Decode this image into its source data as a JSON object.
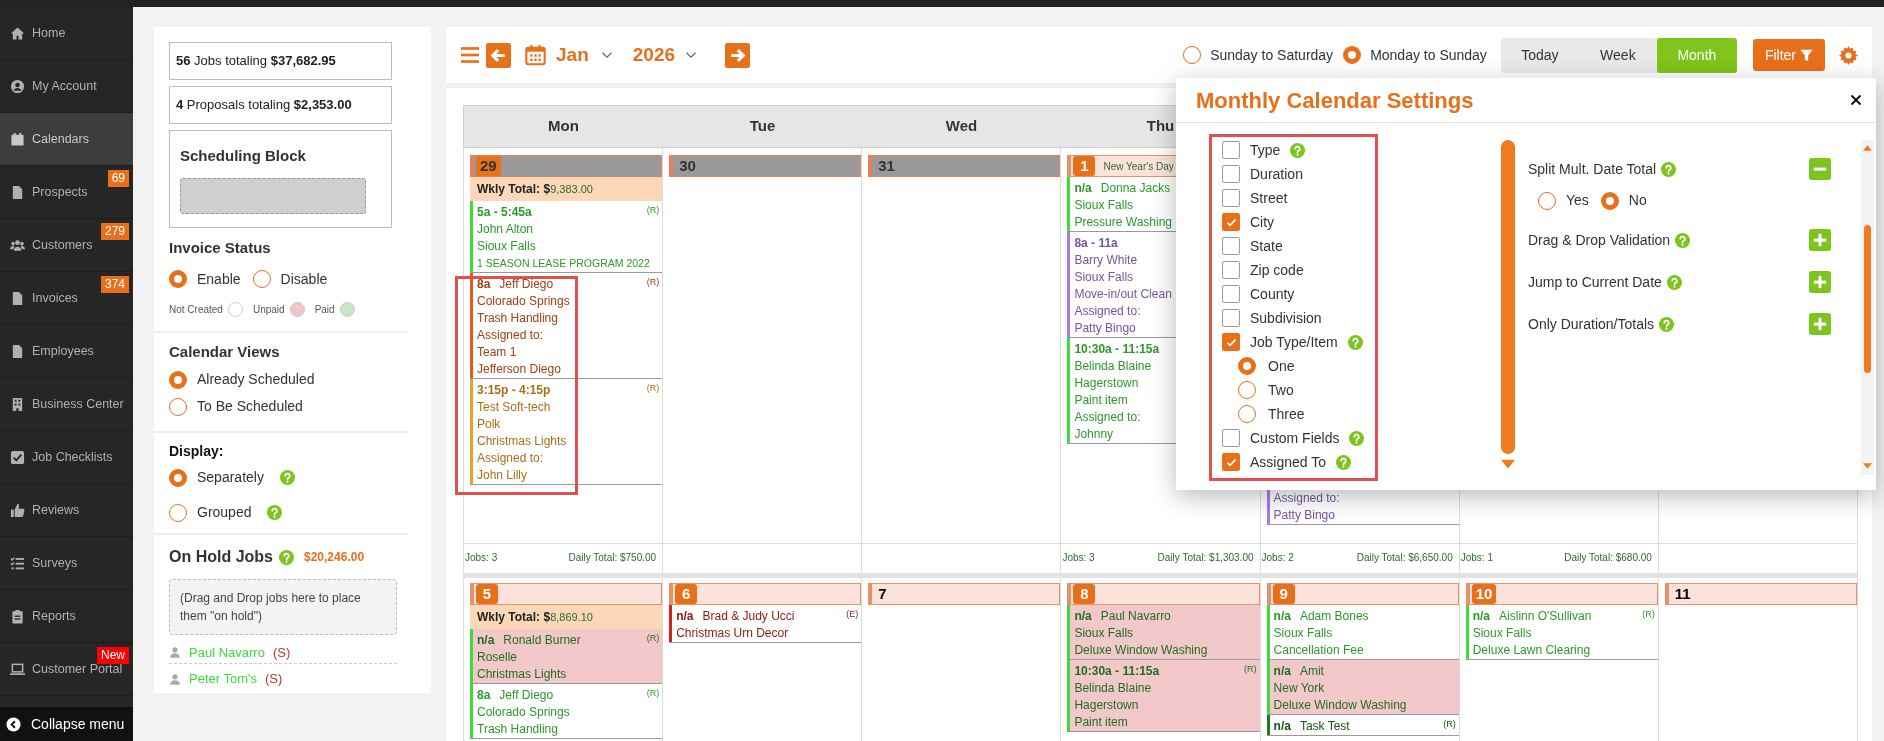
{
  "sidebar": {
    "items": [
      {
        "label": "Home",
        "selected": false
      },
      {
        "label": "My Account",
        "selected": false
      },
      {
        "label": "Calendars",
        "selected": true
      },
      {
        "label": "Prospects",
        "selected": false,
        "badge": {
          "text": "69",
          "color": "#e8701a"
        }
      },
      {
        "label": "Customers",
        "selected": false,
        "badge": {
          "text": "279",
          "color": "#e8701a"
        }
      },
      {
        "label": "Invoices",
        "selected": false,
        "badge": {
          "text": "374",
          "color": "#e8701a"
        }
      },
      {
        "label": "Employees",
        "selected": false
      },
      {
        "label": "Business Center",
        "selected": false
      },
      {
        "label": "Job Checklists",
        "selected": false
      },
      {
        "label": "Reviews",
        "selected": false
      },
      {
        "label": "Surveys",
        "selected": false
      },
      {
        "label": "Reports",
        "selected": false
      },
      {
        "label": "Customer Portal",
        "selected": false,
        "badge": {
          "text": "New",
          "color": "#ff0000"
        }
      }
    ],
    "collapse": "Collapse menu"
  },
  "summary": [
    "**56** Jobs totaling **$37,682.95**",
    "**4** Proposals totaling **$2,353.00**"
  ],
  "scheduling_block": {
    "title": "Scheduling Block"
  },
  "invoice_status": {
    "title": "Invoice Status",
    "options": [
      {
        "label": "Enable",
        "selected": true
      },
      {
        "label": "Disable",
        "selected": false
      }
    ],
    "legend": [
      {
        "label": "Not Created",
        "color": "#ffffff"
      },
      {
        "label": "Unpaid",
        "color": "#f2c6c9"
      },
      {
        "label": "Paid",
        "color": "#c6e8c6"
      }
    ]
  },
  "calendar_views": {
    "title": "Calendar Views",
    "options": [
      {
        "label": "Already Scheduled",
        "selected": true
      },
      {
        "label": "To Be Scheduled",
        "selected": false
      }
    ]
  },
  "display": {
    "title": "Display:",
    "options": [
      {
        "label": "Separately",
        "selected": true
      },
      {
        "label": "Grouped",
        "selected": false
      }
    ]
  },
  "on_hold": {
    "title": "On Hold Jobs",
    "total": "$20,246.00",
    "hint": "(Drag and Drop jobs here to place them \"on hold\")",
    "jobs": [
      {
        "name": "Paul Navarro",
        "tag": "(S)"
      },
      {
        "name": "Peter Tom's",
        "tag": "(S)"
      }
    ]
  },
  "toolbar": {
    "month": "Jan",
    "year": "2026",
    "week_start": [
      {
        "label": "Sunday to Saturday",
        "selected": false
      },
      {
        "label": "Monday to Sunday",
        "selected": true
      }
    ],
    "views": [
      {
        "label": "Today",
        "selected": false
      },
      {
        "label": "Week",
        "selected": false
      },
      {
        "label": "Month",
        "selected": true
      }
    ],
    "filter": "Filter"
  },
  "calendar": {
    "weekdays": [
      "Mon",
      "Tue",
      "Wed",
      "Thu"
    ],
    "weeks": [
      {
        "days": [
          {
            "date": "29",
            "other_month": true,
            "has_jobs": true,
            "weekly_total": {
              "label": "Wkly Total: $",
              "amount": "9,383.00"
            },
            "events": [
              {
                "time": "5a - 5:45a",
                "lines": [
                  "John Alton",
                  "Sioux Falls",
                  "1 SEASON LEASE PROGRAM 2022"
                ],
                "tag": "(R)",
                "color": "#3ddc3d",
                "unpaid": false
              },
              {
                "time": "8a",
                "name": "Jeff Diego",
                "lines": [
                  "Colorado Springs",
                  "Trash Handling",
                  "Assigned to:",
                  "Team 1",
                  "Jefferson Diego"
                ],
                "tag": "(R)",
                "color": "#e8581a",
                "unpaid": false
              },
              {
                "time": "3:15p - 4:15p",
                "lines": [
                  "Test Soft-tech",
                  "Polk",
                  "Christmas Lights",
                  "Assigned to:",
                  "John Lilly"
                ],
                "tag": "(R)",
                "color": "#f0a020",
                "unpaid": false
              }
            ],
            "jobs": "Jobs: 3",
            "daily_total": "Daily Total: $750.00"
          },
          {
            "date": "30",
            "other_month": true,
            "has_jobs": false
          },
          {
            "date": "31",
            "other_month": true,
            "has_jobs": false
          },
          {
            "date": "1",
            "other_month": false,
            "has_jobs": true,
            "holiday": "New Year's Day",
            "events": [
              {
                "time": "n/a",
                "name": "Donna Jacks",
                "lines": [
                  "Sioux Falls",
                  "Pressure Washing"
                ],
                "color": "#3ddc3d",
                "unpaid": false
              },
              {
                "time": "8a - 11a",
                "lines": [
                  "Barry White",
                  "Sioux Falls",
                  "Move-in/out Clean",
                  "Assigned to:",
                  "Patty Bingo"
                ],
                "color": "#a77ae8",
                "unpaid": false
              },
              {
                "time": "10:30a - 11:15a",
                "lines": [
                  "Belinda Blaine",
                  "Hagerstown",
                  "Paint item",
                  "Assigned to:",
                  "Johnny"
                ],
                "color": "#3ddc3d",
                "unpaid": false
              }
            ],
            "jobs": "Jobs: 3",
            "daily_total": "Daily Total: $1,303.00"
          },
          {
            "events": [
              {
                "lines": [
                  "Assigned to:",
                  "Patty Bingo"
                ],
                "color": "#a77ae8",
                "unpaid": false
              }
            ],
            "jobs": "Jobs: 2",
            "daily_total": "Daily Total: $6,650.00"
          },
          {
            "jobs": "Jobs: 1",
            "daily_total": "Daily Total: $680.00"
          }
        ]
      },
      {
        "days": [
          {
            "date": "5",
            "other_month": false,
            "has_jobs": true,
            "weekly_total": {
              "label": "Wkly Total: $",
              "amount": "8,869.10"
            },
            "events": [
              {
                "time": "n/a",
                "name": "Ronald Burner",
                "lines": [
                  "Roselle",
                  "Christmas Lights"
                ],
                "tag": "(R)",
                "color": "#3ddc3d",
                "unpaid": true
              },
              {
                "time": "8a",
                "name": "Jeff Diego",
                "lines": [
                  "Colorado Springs",
                  "Trash Handling"
                ],
                "tag": "(R)",
                "color": "#3ddc3d",
                "unpaid": false
              }
            ]
          },
          {
            "date": "6",
            "other_month": false,
            "has_jobs": true,
            "events": [
              {
                "time": "n/a",
                "name": "Brad & Judy Ucci",
                "lines": [
                  "Christmas Urn Decor"
                ],
                "tag": "(E)",
                "color": "#d42020",
                "unpaid": false
              }
            ]
          },
          {
            "date": "7",
            "other_month": false,
            "has_jobs": false
          },
          {
            "date": "8",
            "other_month": false,
            "has_jobs": true,
            "events": [
              {
                "time": "n/a",
                "name": "Paul Navarro",
                "lines": [
                  "Sioux Falls",
                  "Deluxe Window Washing"
                ],
                "color": "#3ddc3d",
                "unpaid": true
              },
              {
                "time": "10:30a - 11:15a",
                "lines": [
                  "Belinda Blaine",
                  "Hagerstown",
                  "Paint item"
                ],
                "tag": "(R)",
                "color": "#3ddc3d",
                "unpaid": true
              }
            ]
          },
          {
            "date": "9",
            "other_month": false,
            "has_jobs": true,
            "events": [
              {
                "time": "n/a",
                "name": "Adam Bones",
                "lines": [
                  "Sioux Falls",
                  "Cancellation Fee"
                ],
                "color": "#3ddc3d",
                "unpaid": false
              },
              {
                "time": "n/a",
                "name": "Amit",
                "lines": [
                  "New York",
                  "Deluxe Window Washing"
                ],
                "color": "#3ddc3d",
                "unpaid": true
              },
              {
                "time": "n/a",
                "name": "Task Test",
                "tag": "(R)",
                "color": "#1e7a1e",
                "unpaid": false
              }
            ]
          },
          {
            "date": "10",
            "other_month": false,
            "has_jobs": true,
            "events": [
              {
                "time": "n/a",
                "name": "Aislinn O'Sullivan",
                "lines": [
                  "Sioux Falls",
                  "Deluxe Lawn Clearing"
                ],
                "tag": "(R)",
                "color": "#3ddc3d",
                "unpaid": false
              }
            ]
          },
          {
            "date": "11",
            "other_month": false,
            "has_jobs": false
          }
        ]
      }
    ]
  },
  "settings": {
    "title": "Monthly Calendar Settings",
    "fields": [
      {
        "label": "Type",
        "checked": false,
        "help": true
      },
      {
        "label": "Duration",
        "checked": false,
        "help": false
      },
      {
        "label": "Street",
        "checked": false,
        "help": false
      },
      {
        "label": "City",
        "checked": true,
        "help": false
      },
      {
        "label": "State",
        "checked": false,
        "help": false
      },
      {
        "label": "Zip code",
        "checked": false,
        "help": false
      },
      {
        "label": "County",
        "checked": false,
        "help": false
      },
      {
        "label": "Subdivision",
        "checked": false,
        "help": false
      },
      {
        "label": "Job Type/Item",
        "checked": true,
        "help": true,
        "children": [
          {
            "label": "One",
            "selected": true
          },
          {
            "label": "Two",
            "selected": false
          },
          {
            "label": "Three",
            "selected": false
          }
        ]
      },
      {
        "label": "Custom Fields",
        "checked": false,
        "help": true
      },
      {
        "label": "Assigned To",
        "checked": true,
        "help": true
      }
    ],
    "options": [
      {
        "label": "Split Mult. Date Total",
        "expanded": true,
        "choices": [
          {
            "label": "Yes",
            "selected": false
          },
          {
            "label": "No",
            "selected": true
          }
        ]
      },
      {
        "label": "Drag & Drop Validation",
        "expanded": false
      },
      {
        "label": "Jump to Current Date",
        "expanded": false
      },
      {
        "label": "Only Duration/Totals",
        "expanded": false
      }
    ]
  }
}
